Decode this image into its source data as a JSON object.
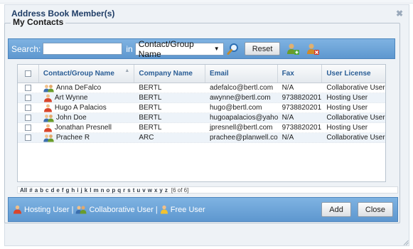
{
  "dialog": {
    "title": "Address Book Member(s)",
    "close_glyph": "✖",
    "section_title": "My Contacts"
  },
  "search": {
    "label": "Search:",
    "value": "",
    "in_label": "in",
    "field_selected": "Contact/Group Name",
    "reset_label": "Reset",
    "icons": [
      "magnifier-icon",
      "add-contact-icon",
      "remove-contact-icon"
    ]
  },
  "table": {
    "columns": [
      "Contact/Group Name",
      "Company Name",
      "Email",
      "Fax",
      "User License"
    ],
    "rows": [
      {
        "name": "Anna DeFalco",
        "company": "BERTL",
        "email": "adefalco@bertl.com",
        "fax": "N/A",
        "license": "Collaborative User",
        "type": "collaborative"
      },
      {
        "name": "Art Wynne",
        "company": "BERTL",
        "email": "awynne@bertl.com",
        "fax": "9738820201",
        "license": "Hosting User",
        "type": "hosting"
      },
      {
        "name": "Hugo A Palacios",
        "company": "BERTL",
        "email": "hugo@bertl.com",
        "fax": "9738820201",
        "license": "Hosting User",
        "type": "hosting"
      },
      {
        "name": "John Doe",
        "company": "BERTL",
        "email": "hugoapalacios@yahoo.c",
        "fax": "N/A",
        "license": "Collaborative User",
        "type": "collaborative"
      },
      {
        "name": "Jonathan Presnell",
        "company": "BERTL",
        "email": "jpresnell@bertl.com",
        "fax": "9738820201",
        "license": "Hosting User",
        "type": "hosting"
      },
      {
        "name": "Prachee R",
        "company": "ARC",
        "email": "prachee@planwell.com",
        "fax": "N/A",
        "license": "Collaborative User",
        "type": "collaborative"
      }
    ]
  },
  "alphabet": {
    "letters": [
      "All",
      "#",
      "a",
      "b",
      "c",
      "d",
      "e",
      "f",
      "g",
      "h",
      "i",
      "j",
      "k",
      "l",
      "m",
      "n",
      "o",
      "p",
      "q",
      "r",
      "s",
      "t",
      "u",
      "v",
      "w",
      "x",
      "y",
      "z"
    ],
    "count": "[6 of 6]"
  },
  "footer": {
    "legend": [
      {
        "label": "Hosting User",
        "icon": "hosting-user-icon"
      },
      {
        "label": "Collaborative User",
        "icon": "collaborative-user-icon"
      },
      {
        "label": "Free User",
        "icon": "free-user-icon"
      }
    ],
    "separator": "|",
    "add_label": "Add",
    "close_label": "Close"
  },
  "colors": {
    "bar_blue": "#6aa3d8",
    "header_text": "#2a5d95",
    "title_text": "#1f3d66"
  }
}
